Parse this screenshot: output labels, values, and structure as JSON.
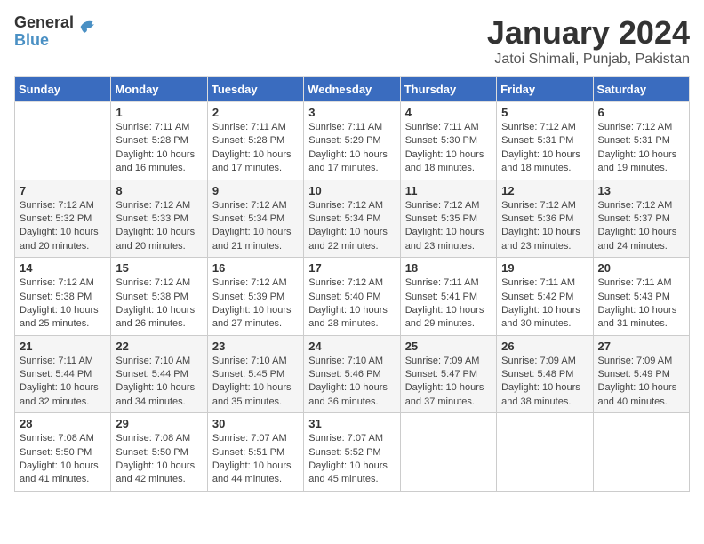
{
  "header": {
    "logo_general": "General",
    "logo_blue": "Blue",
    "month_title": "January 2024",
    "location": "Jatoi Shimali, Punjab, Pakistan"
  },
  "days_of_week": [
    "Sunday",
    "Monday",
    "Tuesday",
    "Wednesday",
    "Thursday",
    "Friday",
    "Saturday"
  ],
  "weeks": [
    [
      {
        "day": "",
        "sunrise": "",
        "sunset": "",
        "daylight": ""
      },
      {
        "day": "1",
        "sunrise": "Sunrise: 7:11 AM",
        "sunset": "Sunset: 5:28 PM",
        "daylight": "Daylight: 10 hours and 16 minutes."
      },
      {
        "day": "2",
        "sunrise": "Sunrise: 7:11 AM",
        "sunset": "Sunset: 5:28 PM",
        "daylight": "Daylight: 10 hours and 17 minutes."
      },
      {
        "day": "3",
        "sunrise": "Sunrise: 7:11 AM",
        "sunset": "Sunset: 5:29 PM",
        "daylight": "Daylight: 10 hours and 17 minutes."
      },
      {
        "day": "4",
        "sunrise": "Sunrise: 7:11 AM",
        "sunset": "Sunset: 5:30 PM",
        "daylight": "Daylight: 10 hours and 18 minutes."
      },
      {
        "day": "5",
        "sunrise": "Sunrise: 7:12 AM",
        "sunset": "Sunset: 5:31 PM",
        "daylight": "Daylight: 10 hours and 18 minutes."
      },
      {
        "day": "6",
        "sunrise": "Sunrise: 7:12 AM",
        "sunset": "Sunset: 5:31 PM",
        "daylight": "Daylight: 10 hours and 19 minutes."
      }
    ],
    [
      {
        "day": "7",
        "sunrise": "Sunrise: 7:12 AM",
        "sunset": "Sunset: 5:32 PM",
        "daylight": "Daylight: 10 hours and 20 minutes."
      },
      {
        "day": "8",
        "sunrise": "Sunrise: 7:12 AM",
        "sunset": "Sunset: 5:33 PM",
        "daylight": "Daylight: 10 hours and 20 minutes."
      },
      {
        "day": "9",
        "sunrise": "Sunrise: 7:12 AM",
        "sunset": "Sunset: 5:34 PM",
        "daylight": "Daylight: 10 hours and 21 minutes."
      },
      {
        "day": "10",
        "sunrise": "Sunrise: 7:12 AM",
        "sunset": "Sunset: 5:34 PM",
        "daylight": "Daylight: 10 hours and 22 minutes."
      },
      {
        "day": "11",
        "sunrise": "Sunrise: 7:12 AM",
        "sunset": "Sunset: 5:35 PM",
        "daylight": "Daylight: 10 hours and 23 minutes."
      },
      {
        "day": "12",
        "sunrise": "Sunrise: 7:12 AM",
        "sunset": "Sunset: 5:36 PM",
        "daylight": "Daylight: 10 hours and 23 minutes."
      },
      {
        "day": "13",
        "sunrise": "Sunrise: 7:12 AM",
        "sunset": "Sunset: 5:37 PM",
        "daylight": "Daylight: 10 hours and 24 minutes."
      }
    ],
    [
      {
        "day": "14",
        "sunrise": "Sunrise: 7:12 AM",
        "sunset": "Sunset: 5:38 PM",
        "daylight": "Daylight: 10 hours and 25 minutes."
      },
      {
        "day": "15",
        "sunrise": "Sunrise: 7:12 AM",
        "sunset": "Sunset: 5:38 PM",
        "daylight": "Daylight: 10 hours and 26 minutes."
      },
      {
        "day": "16",
        "sunrise": "Sunrise: 7:12 AM",
        "sunset": "Sunset: 5:39 PM",
        "daylight": "Daylight: 10 hours and 27 minutes."
      },
      {
        "day": "17",
        "sunrise": "Sunrise: 7:12 AM",
        "sunset": "Sunset: 5:40 PM",
        "daylight": "Daylight: 10 hours and 28 minutes."
      },
      {
        "day": "18",
        "sunrise": "Sunrise: 7:11 AM",
        "sunset": "Sunset: 5:41 PM",
        "daylight": "Daylight: 10 hours and 29 minutes."
      },
      {
        "day": "19",
        "sunrise": "Sunrise: 7:11 AM",
        "sunset": "Sunset: 5:42 PM",
        "daylight": "Daylight: 10 hours and 30 minutes."
      },
      {
        "day": "20",
        "sunrise": "Sunrise: 7:11 AM",
        "sunset": "Sunset: 5:43 PM",
        "daylight": "Daylight: 10 hours and 31 minutes."
      }
    ],
    [
      {
        "day": "21",
        "sunrise": "Sunrise: 7:11 AM",
        "sunset": "Sunset: 5:44 PM",
        "daylight": "Daylight: 10 hours and 32 minutes."
      },
      {
        "day": "22",
        "sunrise": "Sunrise: 7:10 AM",
        "sunset": "Sunset: 5:44 PM",
        "daylight": "Daylight: 10 hours and 34 minutes."
      },
      {
        "day": "23",
        "sunrise": "Sunrise: 7:10 AM",
        "sunset": "Sunset: 5:45 PM",
        "daylight": "Daylight: 10 hours and 35 minutes."
      },
      {
        "day": "24",
        "sunrise": "Sunrise: 7:10 AM",
        "sunset": "Sunset: 5:46 PM",
        "daylight": "Daylight: 10 hours and 36 minutes."
      },
      {
        "day": "25",
        "sunrise": "Sunrise: 7:09 AM",
        "sunset": "Sunset: 5:47 PM",
        "daylight": "Daylight: 10 hours and 37 minutes."
      },
      {
        "day": "26",
        "sunrise": "Sunrise: 7:09 AM",
        "sunset": "Sunset: 5:48 PM",
        "daylight": "Daylight: 10 hours and 38 minutes."
      },
      {
        "day": "27",
        "sunrise": "Sunrise: 7:09 AM",
        "sunset": "Sunset: 5:49 PM",
        "daylight": "Daylight: 10 hours and 40 minutes."
      }
    ],
    [
      {
        "day": "28",
        "sunrise": "Sunrise: 7:08 AM",
        "sunset": "Sunset: 5:50 PM",
        "daylight": "Daylight: 10 hours and 41 minutes."
      },
      {
        "day": "29",
        "sunrise": "Sunrise: 7:08 AM",
        "sunset": "Sunset: 5:50 PM",
        "daylight": "Daylight: 10 hours and 42 minutes."
      },
      {
        "day": "30",
        "sunrise": "Sunrise: 7:07 AM",
        "sunset": "Sunset: 5:51 PM",
        "daylight": "Daylight: 10 hours and 44 minutes."
      },
      {
        "day": "31",
        "sunrise": "Sunrise: 7:07 AM",
        "sunset": "Sunset: 5:52 PM",
        "daylight": "Daylight: 10 hours and 45 minutes."
      },
      {
        "day": "",
        "sunrise": "",
        "sunset": "",
        "daylight": ""
      },
      {
        "day": "",
        "sunrise": "",
        "sunset": "",
        "daylight": ""
      },
      {
        "day": "",
        "sunrise": "",
        "sunset": "",
        "daylight": ""
      }
    ]
  ]
}
